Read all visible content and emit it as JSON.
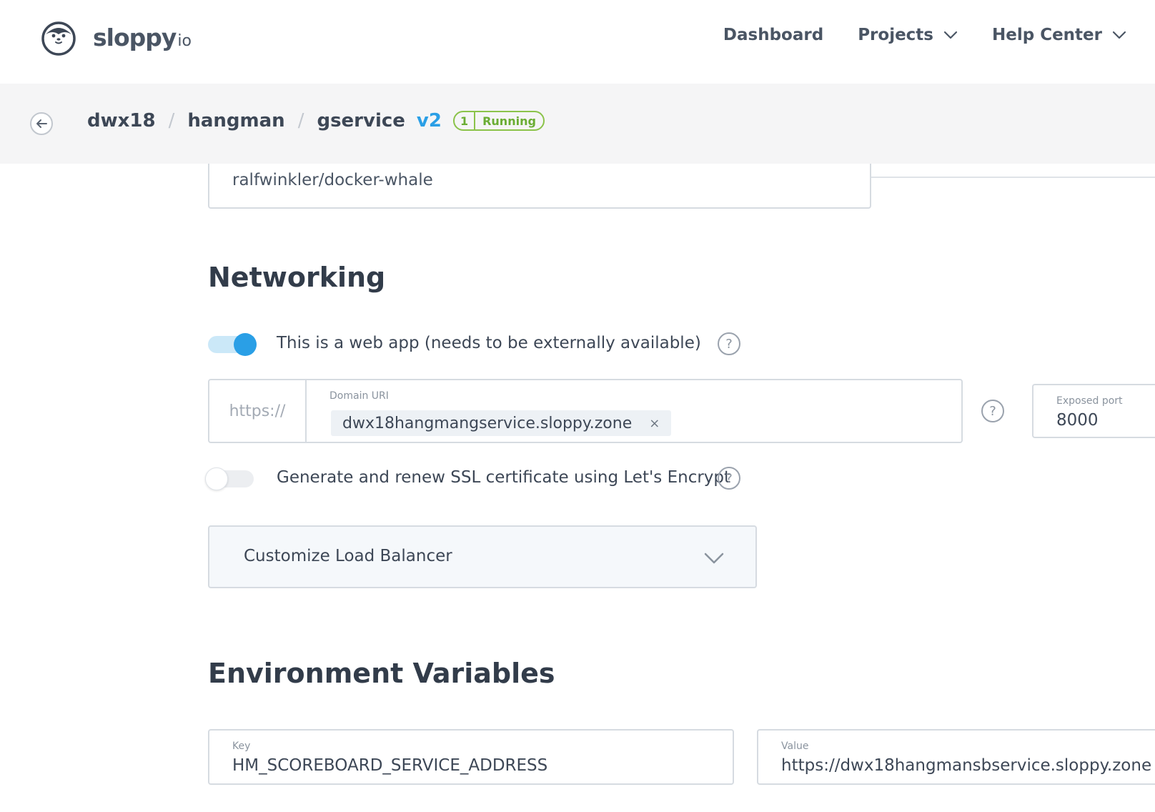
{
  "header": {
    "logo_text": "sloppy",
    "logo_suffix": "io",
    "nav": [
      {
        "label": "Dashboard",
        "has_dropdown": false
      },
      {
        "label": "Projects",
        "has_dropdown": true
      },
      {
        "label": "Help Center",
        "has_dropdown": true
      }
    ]
  },
  "breadcrumb": {
    "project": "dwx18",
    "app": "hangman",
    "service": "gservice",
    "separator": "/",
    "version": "v2",
    "status": {
      "count": "1",
      "label": "Running",
      "color": "#8bc34a"
    }
  },
  "image": {
    "value": "ralfwinkler/docker-whale"
  },
  "networking": {
    "title": "Networking",
    "web_app_toggle": {
      "label": "This is a web app (needs to be externally available)",
      "on": true
    },
    "domain": {
      "prefix": "https://",
      "caption": "Domain URI",
      "value": "dwx18hangmangservice.sloppy.zone",
      "remove": "×"
    },
    "exposed_port": {
      "caption": "Exposed port",
      "value": "8000"
    },
    "ssl_toggle": {
      "label": "Generate and renew SSL certificate using Let's Encrypt",
      "on": false
    },
    "load_balancer": {
      "label": "Customize Load Balancer"
    },
    "help_glyph": "?"
  },
  "environment": {
    "title": "Environment Variables",
    "key_caption": "Key",
    "value_caption": "Value",
    "key": "HM_SCOREBOARD_SERVICE_ADDRESS",
    "value": "https://dwx18hangmansbservice.sloppy.zone"
  },
  "colors": {
    "accent": "#2a9fe6",
    "text": "#3d4756",
    "running": "#8bc34a"
  }
}
